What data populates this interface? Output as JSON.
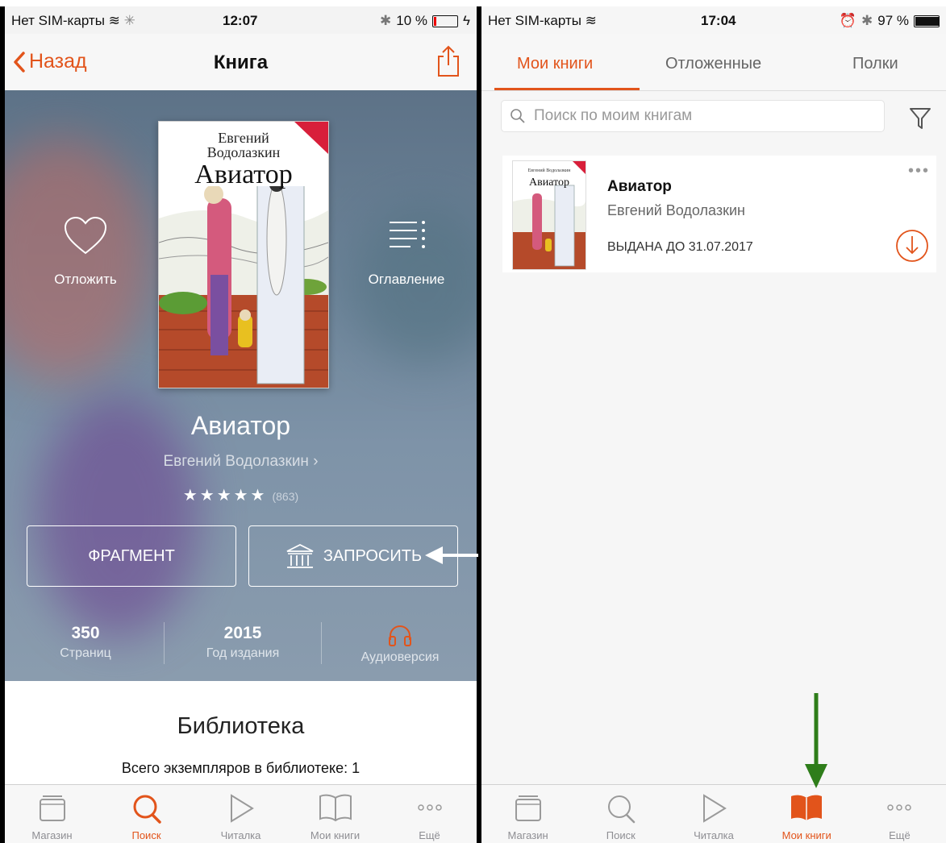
{
  "left": {
    "status": {
      "carrier": "Нет SIM-карты",
      "time": "12:07",
      "battery": "10 %",
      "battery_level": 0.1
    },
    "nav": {
      "back_label": "Назад",
      "title": "Книга"
    },
    "cover": {
      "author_line1": "Евгений",
      "author_line2": "Водолазкин",
      "title": "Авиатор"
    },
    "actions": {
      "defer_label": "Отложить",
      "toc_label": "Оглавление"
    },
    "book": {
      "title": "Авиатор",
      "author": "Евгений Водолазкин",
      "stars": "★★★★★",
      "rating_count": "(863)",
      "rating_value": 5
    },
    "buttons": {
      "fragment": "ФРАГМЕНТ",
      "request": "ЗАПРОСИТЬ"
    },
    "stats": {
      "pages_value": "350",
      "pages_label": "Страниц",
      "year_value": "2015",
      "year_label": "Год издания",
      "audio_label": "Аудиоверсия"
    },
    "library": {
      "heading": "Библиотека",
      "copies": "Всего экземпляров в библиотеке: 1"
    },
    "tabs": {
      "store": "Магазин",
      "search": "Поиск",
      "reader": "Читалка",
      "mybooks": "Мои книги",
      "more": "Ещё"
    }
  },
  "right": {
    "status": {
      "carrier": "Нет SIM-карты",
      "time": "17:04",
      "battery": "97 %",
      "battery_level": 0.97
    },
    "segments": {
      "mybooks": "Мои книги",
      "deferred": "Отложенные",
      "shelves": "Полки"
    },
    "search": {
      "placeholder": "Поиск по моим книгам"
    },
    "item": {
      "title": "Авиатор",
      "author": "Евгений Водолазкин",
      "due": "ВЫДАНА ДО 31.07.2017",
      "more": "•••",
      "cover_author": "Евгений Водолазкин",
      "cover_title": "Авиатор"
    },
    "tabs": {
      "store": "Магазин",
      "search": "Поиск",
      "reader": "Читалка",
      "mybooks": "Мои книги",
      "more": "Ещё"
    }
  },
  "colors": {
    "accent": "#e2541b",
    "annotation_arrow_left": "#ffffff",
    "annotation_arrow_right": "#2e7d1a"
  }
}
